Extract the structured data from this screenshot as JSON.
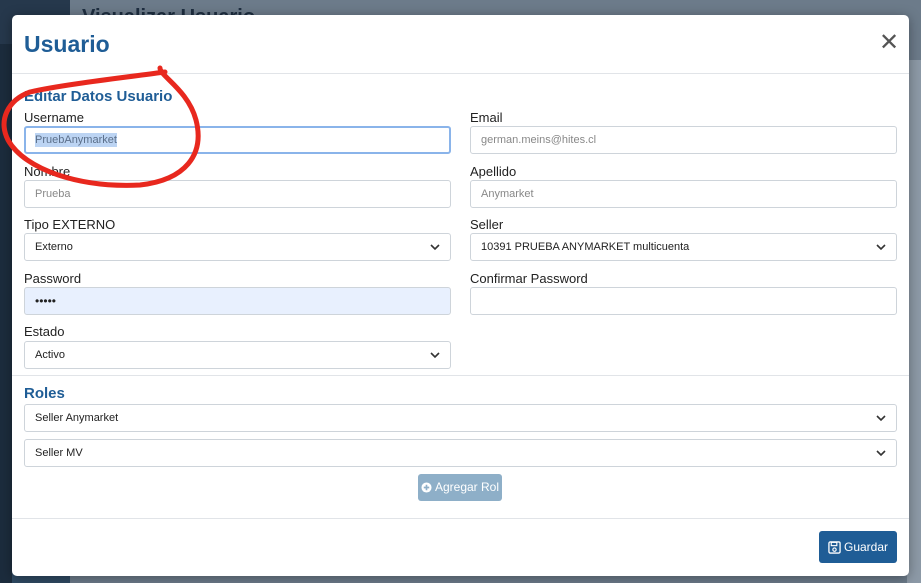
{
  "background": {
    "title": "Visualizar Usuario"
  },
  "modal": {
    "title": "Usuario",
    "section_edit": "Editar Datos Usuario",
    "fields": {
      "username": {
        "label": "Username",
        "value": "PruebAnymarket"
      },
      "email": {
        "label": "Email",
        "placeholder": "german.meins@hites.cl"
      },
      "nombre": {
        "label": "Nombre",
        "placeholder": "Prueba"
      },
      "apellido": {
        "label": "Apellido",
        "placeholder": "Anymarket"
      },
      "tipo": {
        "label": "Tipo EXTERNO",
        "value": "Externo"
      },
      "seller": {
        "label": "Seller",
        "value": "10391 PRUEBA ANYMARKET multicuenta"
      },
      "password": {
        "label": "Password",
        "value": "•••••"
      },
      "confirm": {
        "label": "Confirmar Password",
        "value": ""
      },
      "estado": {
        "label": "Estado",
        "value": "Activo"
      }
    },
    "section_roles": "Roles",
    "roles": [
      "Seller Anymarket",
      "Seller MV"
    ],
    "add_role_label": "Agregar Rol",
    "save_label": "Guardar"
  },
  "colors": {
    "accent": "#1f5d96",
    "annotation": "#e8281e"
  },
  "icons": {
    "close": "close-icon",
    "chevron": "chevron-down-icon",
    "add": "plus-circle-icon",
    "save": "floppy-disk-icon"
  }
}
